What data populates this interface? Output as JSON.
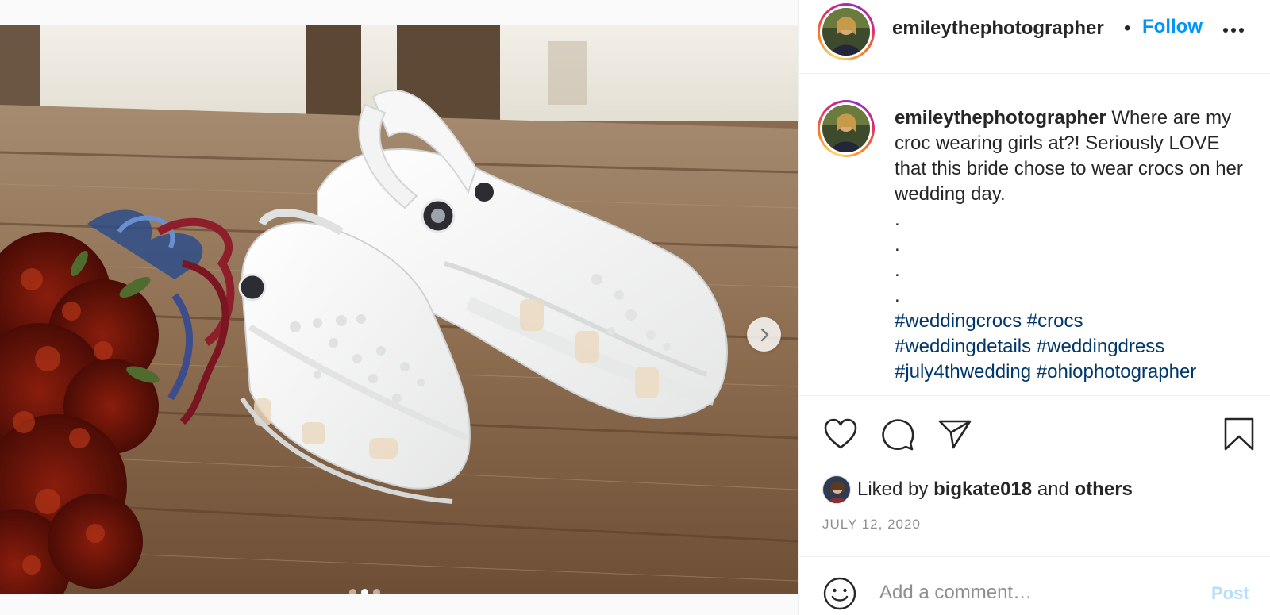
{
  "post": {
    "username": "emileythephotographer",
    "separator": "•",
    "follow_label": "Follow",
    "more_icon": "more-horizontal-icon",
    "media": {
      "alt": "White crocs on a wooden dock beside a red bridal bouquet",
      "carousel_index": 2,
      "carousel_count": 3,
      "next_icon": "chevron-right-icon"
    },
    "caption": {
      "username": "emileythephotographer",
      "text": "Where are my croc wearing girls at?! Seriously LOVE that this bride chose to wear crocs on her wedding day.",
      "dot_lines": [
        ".",
        ".",
        ".",
        "."
      ],
      "hashtags": [
        "#weddingcrocs",
        "#crocs",
        "#weddingdetails",
        "#weddingdress",
        "#july4thwedding",
        "#ohiophotographer"
      ]
    },
    "actions": {
      "like_icon": "heart-icon",
      "comment_icon": "comment-icon",
      "share_icon": "share-icon",
      "save_icon": "bookmark-icon"
    },
    "likes": {
      "prefix": "Liked by",
      "user": "bigkate018",
      "middle": "and",
      "others": "others"
    },
    "date": "JULY 12, 2020",
    "comment": {
      "emoji_icon": "emoji-icon",
      "placeholder": "Add a comment…",
      "post_label": "Post"
    }
  },
  "colors": {
    "follow": "#0095f6",
    "hashtag": "#00376b",
    "post_disabled": "#b2dffc",
    "muted": "#8e8e8e",
    "text": "#262626"
  }
}
